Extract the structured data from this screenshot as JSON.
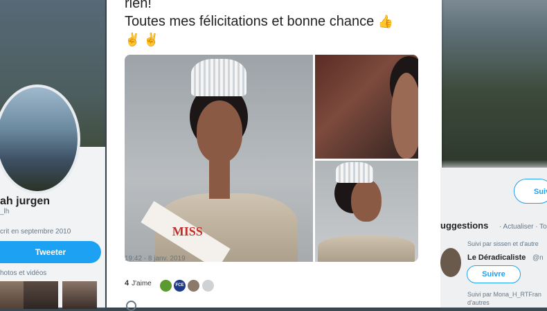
{
  "tweet": {
    "text_line1": "rien!",
    "text_line2": "Toutes mes félicitations et bonne chance",
    "emoji_thumbs": "👍",
    "emoji_victory": "✌ ✌",
    "sash_text": "MISS",
    "timestamp": "19:42 - 8 janv. 2019",
    "likes_count": "4",
    "likes_label": "J'aime",
    "liker2_badge": "FCE"
  },
  "profile": {
    "name": "ah jurgen",
    "handle": "_lh",
    "joined": "crit en septembre 2010",
    "tweet_button": "Tweeter",
    "media_label": "hotos et vidéos"
  },
  "suggestions": {
    "title": "uggestions",
    "refresh": "· Actualiser · Tou",
    "follow_top": "Suiv",
    "item1_meta": "Suivi par sissen et d'autre",
    "item1_name": "Le Déradicaliste",
    "item1_handle": "@n",
    "item1_follow": "Suivre",
    "item2_meta": "Suivi par Mona_H_RTFran",
    "item2_meta_cont": "d'autres"
  },
  "colors": {
    "accent": "#1da1f2",
    "text_muted": "#657786"
  }
}
